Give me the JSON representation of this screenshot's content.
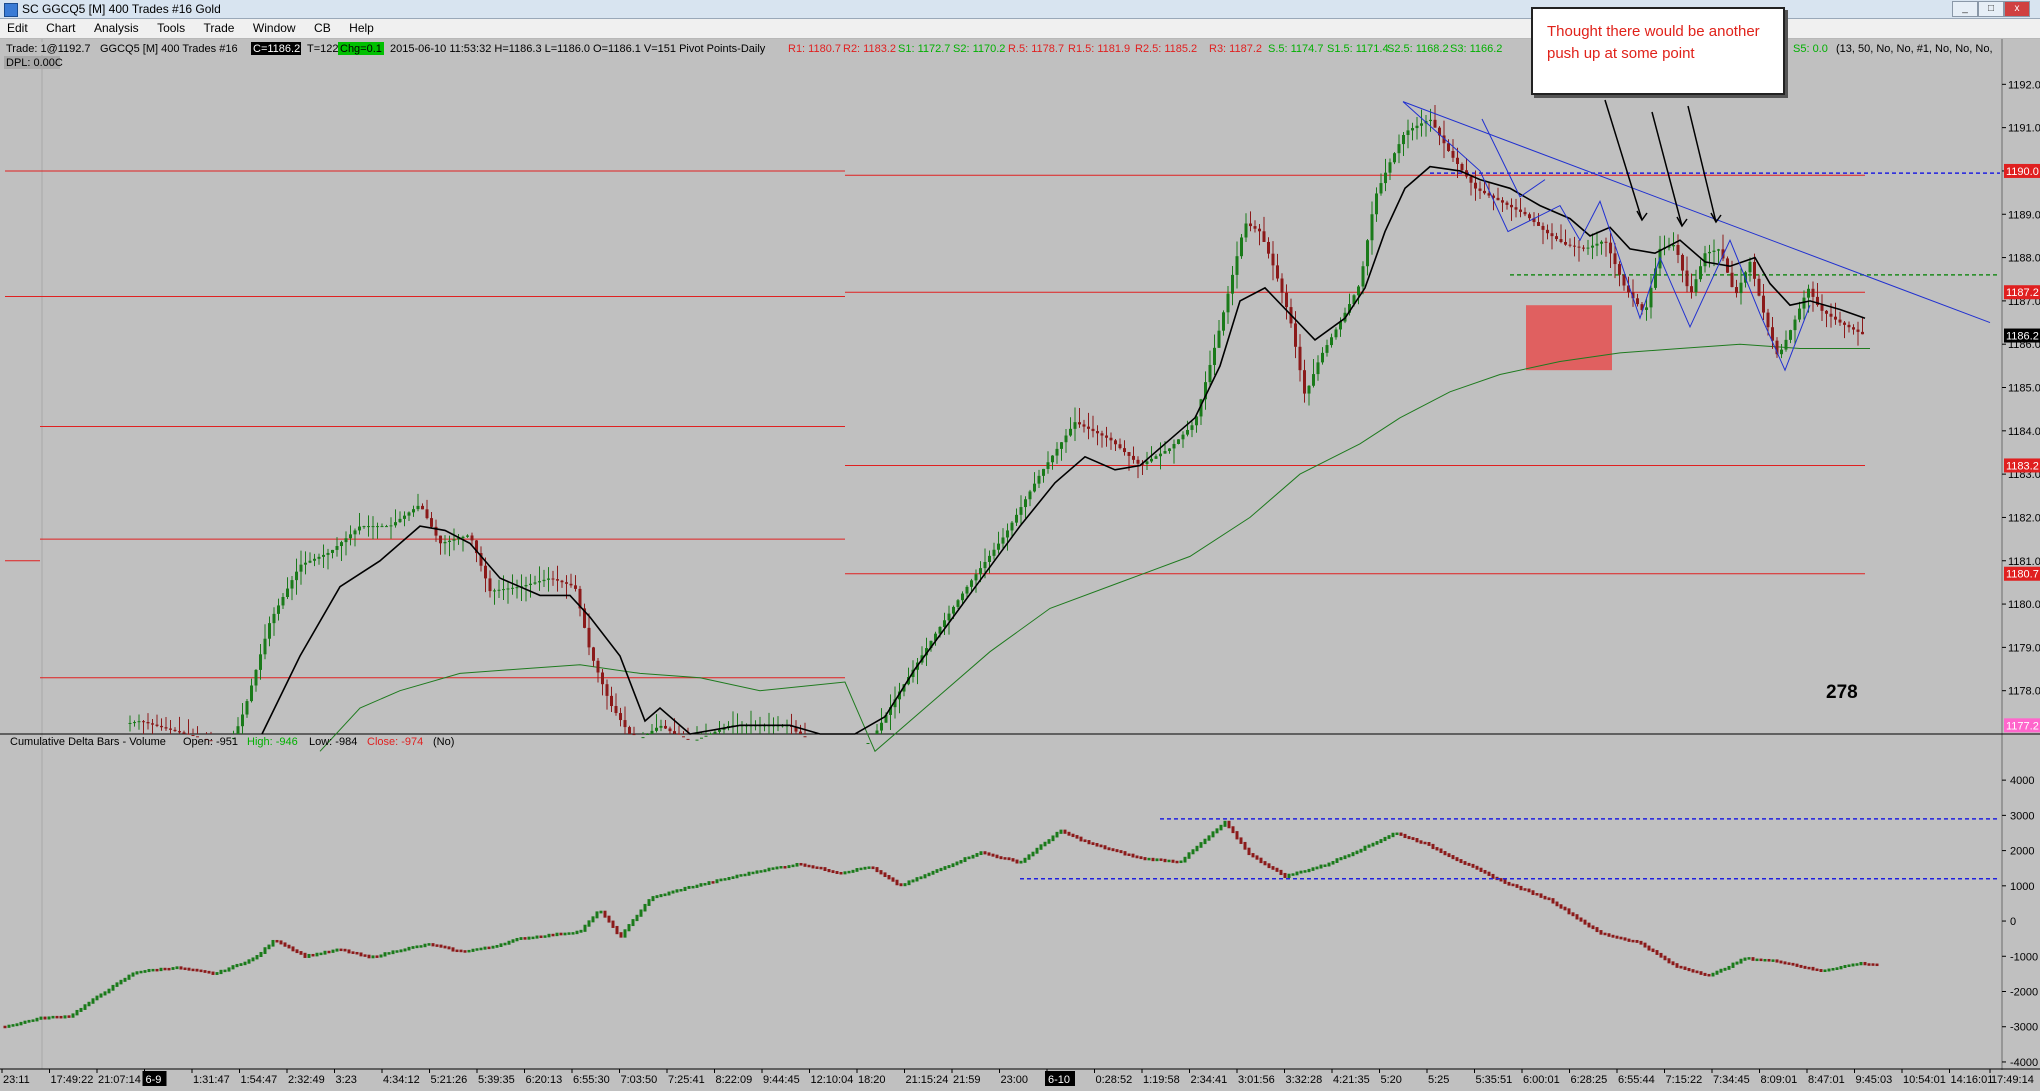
{
  "window": {
    "title": "SC GGCQ5 [M]  400 Trades #16  Gold"
  },
  "menu": [
    "Edit",
    "Chart",
    "Analysis",
    "Tools",
    "Trade",
    "Window",
    "CB",
    "Help"
  ],
  "window_buttons": {
    "minimize": "_",
    "maximize": "□",
    "close": "x"
  },
  "status": {
    "trade": "Trade: 1@1192.7",
    "symbol": "GGCQ5 [M]  400 Trades  #16",
    "close_value": "C=1186.2",
    "ticks": "T=122",
    "change": "Chg=0.1",
    "datetime": "2015-06-10 11:53:32 H=1186.3 L=1186.0 O=1186.1 V=151 Pivot Points-Daily",
    "dpl": "DPL: 0.00C",
    "pivots_red": [
      "R1: 1180.7",
      "R2: 1183.2",
      "R.5: 1178.7",
      "R1.5: 1181.9",
      "R2.5: 1185.2",
      "R3: 1187.2"
    ],
    "pivots_green": [
      "S1: 1172.7",
      "S2: 1170.2",
      "S.5: 1174.7",
      "S1.5: 1171.4",
      "S2.5: 1168.2",
      "S3: 1166.2"
    ],
    "pivots_tail_green": "S5: 0.0",
    "params": "(13, 50, No, No, #1, No, No, No,"
  },
  "annotation": {
    "note": "Thought there would be another push up at some point",
    "count_label": "278"
  },
  "price_badges": [
    "1190.0",
    "1187.2",
    "1186.2",
    "1183.2",
    "1180.7",
    "1177.2"
  ],
  "delta_panel": {
    "title": "Cumulative Delta Bars - Volume",
    "open": "Open: -951",
    "high": "High: -946",
    "low": "Low: -984",
    "close": "Close: -974",
    "flag": "(No)"
  },
  "colors": {
    "background": "#c0c0c0",
    "up_candle": "#1a7a1a",
    "down_candle": "#8b1a1a",
    "pivot_line": "#e02020",
    "trendline": "#2030d0",
    "ma_fast": "#000000",
    "ma_slow": "#1e7a1e",
    "note_text": "#e0221a",
    "zone_box": "#e06060"
  },
  "chart_data": {
    "type": "candlestick",
    "price_axis": {
      "ylim": [
        1177.0,
        1192.4
      ],
      "ticks": [
        1192.0,
        1191.0,
        1190.0,
        1189.0,
        1188.0,
        1187.0,
        1186.0,
        1185.0,
        1184.0,
        1183.0,
        1182.0,
        1181.0,
        1180.0,
        1179.0,
        1178.0
      ]
    },
    "delta_axis": {
      "ylim": [
        -4200,
        4600
      ],
      "ticks": [
        4000,
        3000,
        2000,
        1000,
        0,
        -1000,
        -2000,
        -3000,
        -4000
      ]
    },
    "time_labels": [
      "23:11",
      "17:49:22",
      "21:07:14",
      "6-9",
      "1:31:47",
      "1:54:47",
      "2:32:49",
      "3:23",
      "4:34:12",
      "5:21:26",
      "5:39:35",
      "6:20:13",
      "6:55:30",
      "7:03:50",
      "7:25:41",
      "8:22:09",
      "9:44:45",
      "12:10:04",
      "18:20",
      "21:15:24",
      "21:59",
      "23:00",
      "6-10",
      "0:28:52",
      "1:19:58",
      "2:34:41",
      "3:01:56",
      "3:32:28",
      "4:21:35",
      "5:20",
      "5:25",
      "5:35:51",
      "6:00:01",
      "6:28:25",
      "6:55:44",
      "7:15:22",
      "7:34:45",
      "8:09:01",
      "8:47:01",
      "9:45:03",
      "10:54:01",
      "14:16:01",
      "17:49:14"
    ],
    "highlighted_time_labels": [
      "6-9",
      "6-10"
    ],
    "price_path": [
      [
        30,
        1176.8
      ],
      [
        140,
        1177.3
      ],
      [
        230,
        1176.7
      ],
      [
        245,
        1177.6
      ],
      [
        270,
        1179.6
      ],
      [
        300,
        1180.9
      ],
      [
        330,
        1181.2
      ],
      [
        360,
        1181.8
      ],
      [
        390,
        1181.8
      ],
      [
        420,
        1182.3
      ],
      [
        440,
        1181.4
      ],
      [
        470,
        1181.6
      ],
      [
        490,
        1180.3
      ],
      [
        520,
        1180.4
      ],
      [
        550,
        1180.6
      ],
      [
        575,
        1180.4
      ],
      [
        590,
        1178.9
      ],
      [
        610,
        1177.7
      ],
      [
        635,
        1176.8
      ],
      [
        660,
        1177.2
      ],
      [
        690,
        1176.8
      ],
      [
        730,
        1177.2
      ],
      [
        790,
        1177.2
      ],
      [
        815,
        1176.6
      ],
      [
        845,
        1176.7
      ],
      [
        870,
        1176.8
      ],
      [
        900,
        1178.0
      ],
      [
        935,
        1179.3
      ],
      [
        970,
        1180.5
      ],
      [
        1005,
        1181.6
      ],
      [
        1040,
        1183.0
      ],
      [
        1075,
        1184.2
      ],
      [
        1110,
        1183.8
      ],
      [
        1140,
        1183.2
      ],
      [
        1170,
        1183.6
      ],
      [
        1195,
        1184.2
      ],
      [
        1220,
        1186.4
      ],
      [
        1245,
        1188.8
      ],
      [
        1260,
        1188.6
      ],
      [
        1275,
        1187.7
      ],
      [
        1290,
        1186.6
      ],
      [
        1305,
        1184.8
      ],
      [
        1320,
        1185.7
      ],
      [
        1340,
        1186.5
      ],
      [
        1360,
        1187.4
      ],
      [
        1375,
        1189.4
      ],
      [
        1390,
        1190.2
      ],
      [
        1405,
        1190.9
      ],
      [
        1430,
        1191.2
      ],
      [
        1450,
        1190.4
      ],
      [
        1475,
        1189.6
      ],
      [
        1500,
        1189.3
      ],
      [
        1525,
        1189.0
      ],
      [
        1545,
        1188.6
      ],
      [
        1565,
        1188.3
      ],
      [
        1585,
        1188.2
      ],
      [
        1605,
        1188.4
      ],
      [
        1625,
        1187.3
      ],
      [
        1645,
        1186.7
      ],
      [
        1660,
        1188.2
      ],
      [
        1675,
        1188.3
      ],
      [
        1690,
        1187.1
      ],
      [
        1705,
        1188.1
      ],
      [
        1720,
        1188.2
      ],
      [
        1735,
        1187.1
      ],
      [
        1750,
        1187.9
      ],
      [
        1765,
        1186.6
      ],
      [
        1778,
        1185.7
      ],
      [
        1792,
        1186.4
      ],
      [
        1808,
        1187.3
      ],
      [
        1820,
        1186.8
      ],
      [
        1840,
        1186.5
      ],
      [
        1865,
        1186.2
      ]
    ],
    "delta_path": [
      [
        5,
        -3000
      ],
      [
        40,
        -2760
      ],
      [
        70,
        -2700
      ],
      [
        100,
        -2100
      ],
      [
        135,
        -1450
      ],
      [
        175,
        -1320
      ],
      [
        215,
        -1500
      ],
      [
        255,
        -1050
      ],
      [
        275,
        -530
      ],
      [
        305,
        -1000
      ],
      [
        340,
        -810
      ],
      [
        370,
        -1040
      ],
      [
        400,
        -820
      ],
      [
        430,
        -660
      ],
      [
        460,
        -870
      ],
      [
        490,
        -750
      ],
      [
        520,
        -500
      ],
      [
        550,
        -400
      ],
      [
        580,
        -300
      ],
      [
        600,
        320
      ],
      [
        620,
        -460
      ],
      [
        650,
        640
      ],
      [
        685,
        930
      ],
      [
        720,
        1160
      ],
      [
        760,
        1430
      ],
      [
        800,
        1620
      ],
      [
        840,
        1360
      ],
      [
        870,
        1540
      ],
      [
        900,
        1000
      ],
      [
        940,
        1470
      ],
      [
        980,
        1950
      ],
      [
        1020,
        1660
      ],
      [
        1060,
        2560
      ],
      [
        1090,
        2200
      ],
      [
        1140,
        1780
      ],
      [
        1180,
        1680
      ],
      [
        1225,
        2800
      ],
      [
        1250,
        1880
      ],
      [
        1285,
        1270
      ],
      [
        1325,
        1590
      ],
      [
        1365,
        2090
      ],
      [
        1395,
        2500
      ],
      [
        1425,
        2200
      ],
      [
        1460,
        1700
      ],
      [
        1500,
        1150
      ],
      [
        1550,
        600
      ],
      [
        1600,
        -350
      ],
      [
        1640,
        -620
      ],
      [
        1675,
        -1280
      ],
      [
        1710,
        -1550
      ],
      [
        1745,
        -1060
      ],
      [
        1780,
        -1150
      ],
      [
        1820,
        -1420
      ],
      [
        1860,
        -1200
      ],
      [
        1880,
        -1250
      ]
    ],
    "ma_fast_path": [
      [
        262,
        1176.8
      ],
      [
        300,
        1178.8
      ],
      [
        340,
        1180.4
      ],
      [
        380,
        1181.0
      ],
      [
        420,
        1181.8
      ],
      [
        445,
        1181.7
      ],
      [
        470,
        1181.4
      ],
      [
        500,
        1180.6
      ],
      [
        540,
        1180.2
      ],
      [
        570,
        1180.2
      ],
      [
        590,
        1179.7
      ],
      [
        620,
        1178.8
      ],
      [
        645,
        1177.3
      ],
      [
        660,
        1177.6
      ],
      [
        690,
        1176.8
      ],
      [
        740,
        1177.2
      ],
      [
        790,
        1177.2
      ],
      [
        820,
        1176.9
      ],
      [
        855,
        1176.6
      ],
      [
        885,
        1177.4
      ],
      [
        915,
        1178.5
      ],
      [
        950,
        1179.6
      ],
      [
        985,
        1180.7
      ],
      [
        1020,
        1181.8
      ],
      [
        1055,
        1182.8
      ],
      [
        1085,
        1183.4
      ],
      [
        1115,
        1183.1
      ],
      [
        1140,
        1183.2
      ],
      [
        1165,
        1183.7
      ],
      [
        1195,
        1184.3
      ],
      [
        1220,
        1185.5
      ],
      [
        1240,
        1187.0
      ],
      [
        1265,
        1187.3
      ],
      [
        1290,
        1186.7
      ],
      [
        1315,
        1186.1
      ],
      [
        1345,
        1186.6
      ],
      [
        1365,
        1187.3
      ],
      [
        1385,
        1188.6
      ],
      [
        1405,
        1189.6
      ],
      [
        1430,
        1190.1
      ],
      [
        1460,
        1190.0
      ],
      [
        1480,
        1189.8
      ],
      [
        1510,
        1189.6
      ],
      [
        1540,
        1189.2
      ],
      [
        1570,
        1188.9
      ],
      [
        1590,
        1188.5
      ],
      [
        1610,
        1188.7
      ],
      [
        1630,
        1188.2
      ],
      [
        1655,
        1188.1
      ],
      [
        1680,
        1188.4
      ],
      [
        1705,
        1187.9
      ],
      [
        1730,
        1187.8
      ],
      [
        1755,
        1188.0
      ],
      [
        1770,
        1187.4
      ],
      [
        1790,
        1186.9
      ],
      [
        1810,
        1187.0
      ],
      [
        1840,
        1186.8
      ],
      [
        1865,
        1186.6
      ]
    ],
    "ma_slow_path": [
      [
        320,
        1176.6
      ],
      [
        360,
        1177.6
      ],
      [
        400,
        1178.0
      ],
      [
        460,
        1178.4
      ],
      [
        520,
        1178.5
      ],
      [
        580,
        1178.6
      ],
      [
        640,
        1178.4
      ],
      [
        700,
        1178.3
      ],
      [
        760,
        1178.0
      ],
      [
        845,
        1178.2
      ],
      [
        875,
        1176.6
      ],
      [
        935,
        1177.8
      ],
      [
        990,
        1178.9
      ],
      [
        1050,
        1179.9
      ],
      [
        1120,
        1180.5
      ],
      [
        1190,
        1181.1
      ],
      [
        1250,
        1182.0
      ],
      [
        1300,
        1183.0
      ],
      [
        1360,
        1183.7
      ],
      [
        1400,
        1184.3
      ],
      [
        1450,
        1184.9
      ],
      [
        1500,
        1185.3
      ],
      [
        1560,
        1185.6
      ],
      [
        1620,
        1185.8
      ],
      [
        1680,
        1185.9
      ],
      [
        1740,
        1186.0
      ],
      [
        1800,
        1185.9
      ],
      [
        1870,
        1185.9
      ]
    ],
    "pivots": [
      {
        "x": [
          40,
          845
        ],
        "y": 1190.0
      },
      {
        "x": [
          40,
          845
        ],
        "y": 1187.1
      },
      {
        "x": [
          40,
          845
        ],
        "y": 1184.1
      },
      {
        "x": [
          40,
          845
        ],
        "y": 1181.5
      },
      {
        "x": [
          40,
          845
        ],
        "y": 1178.3
      },
      {
        "x": [
          845,
          1865
        ],
        "y": 1189.9
      },
      {
        "x": [
          845,
          1865
        ],
        "y": 1187.2
      },
      {
        "x": [
          845,
          1865
        ],
        "y": 1183.2
      },
      {
        "x": [
          845,
          1865
        ],
        "y": 1180.7
      }
    ],
    "left_ticks": [
      1190.0,
      1187.1,
      1181.0
    ],
    "trendlines": [
      [
        [
          1403,
          1191.6
        ],
        [
          1990,
          1186.5
        ]
      ]
    ],
    "zigzag": [
      [
        [
          1403,
          1191.6
        ],
        [
          1480,
          1190.0
        ],
        [
          1508,
          1188.6
        ],
        [
          1560,
          1189.2
        ],
        [
          1580,
          1188.4
        ],
        [
          1600,
          1189.3
        ],
        [
          1640,
          1186.6
        ],
        [
          1660,
          1188.0
        ],
        [
          1690,
          1186.4
        ],
        [
          1730,
          1188.4
        ],
        [
          1760,
          1186.7
        ],
        [
          1785,
          1185.4
        ],
        [
          1810,
          1186.9
        ]
      ],
      [
        [
          1482,
          1191.2
        ],
        [
          1520,
          1189.4
        ],
        [
          1545,
          1189.8
        ]
      ]
    ],
    "dashed_levels_price": [
      {
        "x": [
          1430,
          2000
        ],
        "y": 1189.95,
        "color": "#2020e0"
      },
      {
        "x": [
          1510,
          2000
        ],
        "y": 1187.6,
        "color": "#1c8a1c"
      }
    ],
    "dashed_levels_delta": [
      {
        "x": [
          1160,
          2000
        ],
        "y": 2900
      },
      {
        "x": [
          1020,
          2000
        ],
        "y": 1200
      }
    ],
    "arrows": [
      [
        [
          1605,
          100
        ],
        [
          1642,
          220
        ]
      ],
      [
        [
          1652,
          112
        ],
        [
          1682,
          226
        ]
      ],
      [
        [
          1688,
          106
        ],
        [
          1716,
          222
        ]
      ]
    ],
    "zone": {
      "x": [
        1526,
        1612
      ],
      "y": [
        1185.4,
        1186.9
      ]
    }
  }
}
